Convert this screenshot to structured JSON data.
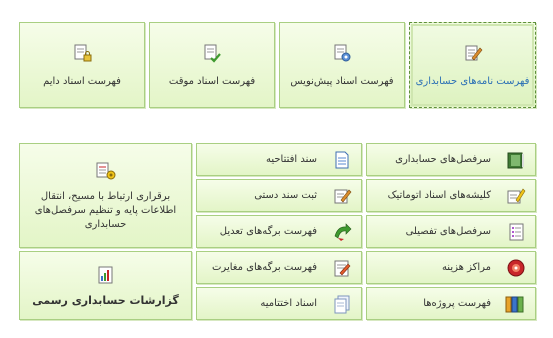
{
  "top_tiles": [
    {
      "label": "فهرست نامه‌های حسابداری",
      "icon": "document-pencil-icon",
      "selected": true
    },
    {
      "label": "فهرست اسناد پیش‌نویس",
      "icon": "document-gear-icon"
    },
    {
      "label": "فهرست اسناد موقت",
      "icon": "document-check-icon"
    },
    {
      "label": "فهرست اسناد دایم",
      "icon": "document-lock-icon"
    }
  ],
  "right_column": [
    {
      "label": "سرفصل‌های حسابداری",
      "icon": "ledger-book-icon"
    },
    {
      "label": "کلیشه‌های اسناد اتوماتیک",
      "icon": "template-pen-icon"
    },
    {
      "label": "سرفصل‌های تفصیلی",
      "icon": "detail-list-icon"
    },
    {
      "label": "مراکز هزینه",
      "icon": "cost-center-icon"
    },
    {
      "label": "فهرست پروژه‌ها",
      "icon": "project-binders-icon"
    }
  ],
  "middle_column": [
    {
      "label": "سند افتتاحیه",
      "icon": "opening-document-icon"
    },
    {
      "label": "ثبت سند دستی",
      "icon": "manual-entry-icon"
    },
    {
      "label": "فهرست برگه‌های تعدیل",
      "icon": "adjustment-arrow-icon"
    },
    {
      "label": "فهرست برگه‌های مغایرت",
      "icon": "discrepancy-sheet-icon"
    },
    {
      "label": "اسناد اختتامیه",
      "icon": "closing-documents-icon"
    }
  ],
  "left_column": [
    {
      "label": "برقراری ارتباط با مسیح، انتقال اطلاعات پایه و تنظیم سرفصل‌های حسابداری",
      "icon": "data-transfer-icon"
    },
    {
      "label": "گزارشات حسابداری رسمی",
      "icon": "report-chart-icon"
    }
  ]
}
